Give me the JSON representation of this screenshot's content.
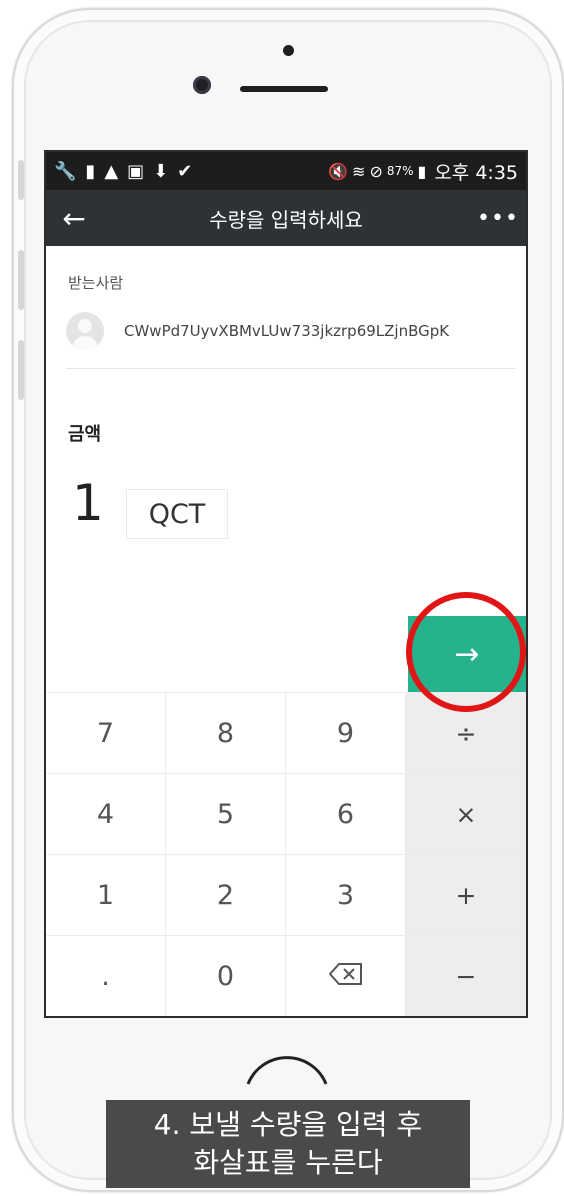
{
  "status_bar": {
    "battery": "87%",
    "time": "오후 4:35"
  },
  "header": {
    "title": "수량을 입력하세요",
    "back_label": "←",
    "more_label": "•••"
  },
  "recipient": {
    "label": "받는사람",
    "address": "CWwPd7UyvXBMvLUw733jkzrp69LZjnBGpK"
  },
  "amount": {
    "label": "금액",
    "value": "1",
    "unit": "QCT"
  },
  "next_button": {
    "label": "→"
  },
  "keypad": {
    "keys": [
      "7",
      "8",
      "9",
      "÷",
      "4",
      "5",
      "6",
      "×",
      "1",
      "2",
      "3",
      "+",
      ".",
      "0",
      "⌫",
      "−"
    ]
  },
  "caption": {
    "line1": "4. 보낼 수량을 입력 후",
    "line2": "화살표를 누른다"
  },
  "colors": {
    "accent": "#26b28d",
    "toolbar": "#2c3236",
    "status_bar": "#1d1d1d",
    "highlight": "#e01515"
  }
}
